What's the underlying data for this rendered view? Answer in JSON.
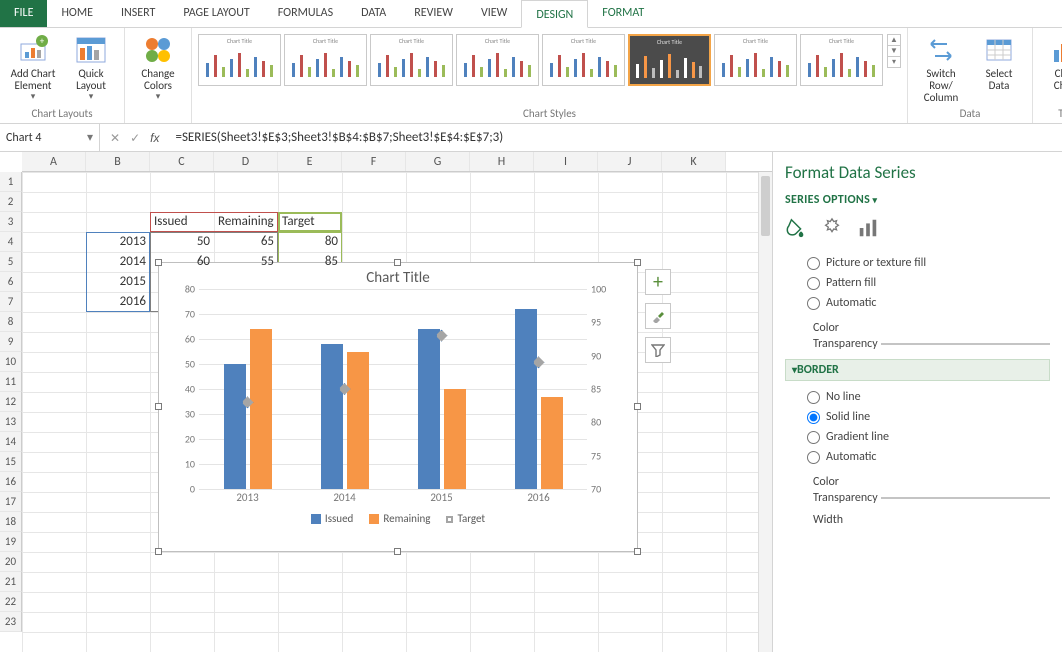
{
  "tabs": {
    "file": "FILE",
    "list": [
      "HOME",
      "INSERT",
      "PAGE LAYOUT",
      "FORMULAS",
      "DATA",
      "REVIEW",
      "VIEW",
      "DESIGN",
      "FORMAT"
    ],
    "active": "DESIGN"
  },
  "ribbon": {
    "chart_layouts": {
      "title": "Chart Layouts",
      "add_element": "Add Chart\nElement",
      "quick_layout": "Quick\nLayout"
    },
    "change_colors": "Change\nColors",
    "chart_styles": {
      "title": "Chart Styles"
    },
    "data": {
      "title": "Data",
      "switch": "Switch Row/\nColumn",
      "select": "Select\nData"
    },
    "type": {
      "title": "Typ",
      "change": "Chan\nChart"
    }
  },
  "namebox": "Chart 4",
  "formula": "=SERIES(Sheet3!$E$3;Sheet3!$B$4:$B$7;Sheet3!$E$4:$E$7;3)",
  "columns": [
    "A",
    "B",
    "C",
    "D",
    "E",
    "F",
    "G",
    "H",
    "I",
    "J",
    "K"
  ],
  "row_count": 23,
  "cells": {
    "headers": {
      "C3": "Issued",
      "D3": "Remaining",
      "E3": "Target"
    },
    "years": {
      "B4": "2013",
      "B5": "2014",
      "B6": "2015",
      "B7": "2016"
    },
    "values": {
      "C4": "50",
      "D4": "65",
      "E4": "80",
      "C5": "60",
      "D5": "55",
      "E5": "85"
    }
  },
  "chart": {
    "title": "Chart Title",
    "legend": {
      "issued": "Issued",
      "remaining": "Remaining",
      "target": "Target"
    },
    "categories": [
      "2013",
      "2014",
      "2015",
      "2016"
    ],
    "y1": {
      "min": 0,
      "max": 80,
      "step": 10
    },
    "y2": {
      "min": 70,
      "max": 100,
      "step": 5
    }
  },
  "chart_data": {
    "type": "bar",
    "title": "Chart Title",
    "categories": [
      "2013",
      "2014",
      "2015",
      "2016"
    ],
    "series": [
      {
        "name": "Issued",
        "axis": "primary",
        "values": [
          50,
          58,
          64,
          72
        ]
      },
      {
        "name": "Remaining",
        "axis": "primary",
        "values": [
          64,
          55,
          40,
          37
        ]
      },
      {
        "name": "Target",
        "axis": "secondary",
        "type": "marker",
        "values": [
          83,
          85,
          93,
          89
        ]
      }
    ],
    "y_primary": {
      "min": 0,
      "max": 80,
      "step": 10,
      "label": ""
    },
    "y_secondary": {
      "min": 70,
      "max": 100,
      "step": 5,
      "label": ""
    },
    "xlabel": "",
    "legend_position": "bottom",
    "grid": true
  },
  "pane": {
    "title": "Format Data Series",
    "series_options": "SERIES OPTIONS",
    "fill": {
      "picture": "Picture or texture fill",
      "pattern": "Pattern fill",
      "auto": "Automatic",
      "color": "Color",
      "transparency": "Transparency"
    },
    "border": {
      "header": "BORDER",
      "noline": "No line",
      "solid": "Solid line",
      "gradient": "Gradient line",
      "auto": "Automatic",
      "color": "Color",
      "transparency": "Transparency",
      "width": "Width"
    }
  }
}
